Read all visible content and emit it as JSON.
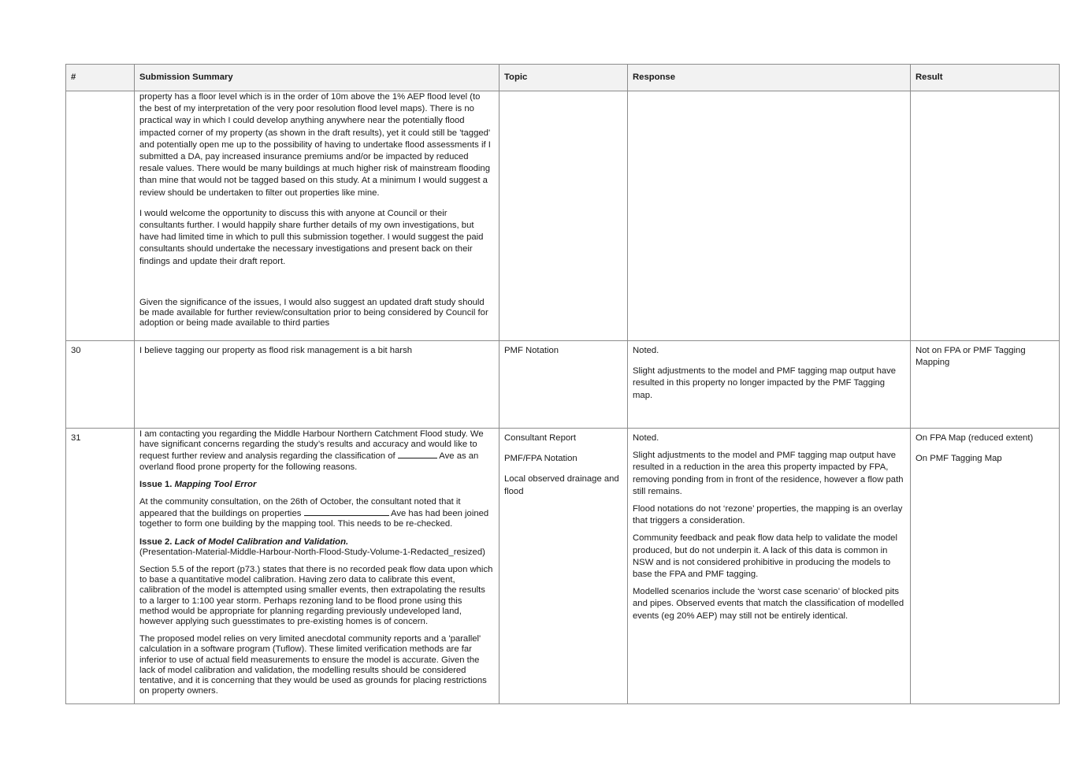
{
  "headers": {
    "num": "#",
    "summary": "Submission Summary",
    "topic": "Topic",
    "response": "Response",
    "result": "Result"
  },
  "row_cont": {
    "p1": "property has a floor level which is in the order of 10m above the 1% AEP flood level (to the best of my interpretation of the very poor resolution flood level maps). There is no practical way in which I could develop anything anywhere near the potentially flood impacted corner of my property (as shown in the draft results), yet it could still be 'tagged' and potentially open me up to the possibility of having to undertake flood assessments if I submitted a DA, pay increased insurance premiums and/or be impacted by reduced resale values. There would be many buildings at much higher risk of mainstream flooding than mine that would not be tagged based on this study. At a minimum I would suggest a review should be undertaken to filter out properties like mine.",
    "p2": "I would welcome the opportunity to discuss this with anyone at Council or their consultants further. I would happily share further details of my own investigations, but have had limited time in which to pull this submission together. I would suggest the paid consultants should undertake the necessary investigations and present back on their findings and update their draft report.",
    "p3": "Given the significance of the issues, I would also suggest an updated draft study should be made available for further review/consultation prior to being considered by Council for adoption or being made available to third parties"
  },
  "row30": {
    "num": "30",
    "summary": "I believe tagging our property as flood risk management is a bit harsh",
    "topic": "PMF Notation",
    "response_1": "Noted.",
    "response_2": "Slight adjustments to the model and PMF tagging map output have resulted in this property no longer impacted by the PMF Tagging map.",
    "result": "Not on FPA or PMF Tagging Mapping"
  },
  "row31": {
    "num": "31",
    "s_p1a": "I am contacting you regarding the Middle Harbour Northern Catchment Flood study. We have significant concerns regarding the study’s results and accuracy and would like to request further review and analysis regarding the classification of ",
    "s_p1b": " Ave as an overland flood prone property for the following reasons.",
    "issue1_label": "Issue 1. ",
    "issue1_title": "Mapping Tool Error",
    "s_p2a": "At the community consultation, on the 26th of October, the consultant noted that it appeared that the buildings on properties ",
    "s_p2b": " Ave has had been joined together to form one building by the mapping tool. This needs to be re-checked.",
    "issue2_label": "Issue 2. ",
    "issue2_title": "Lack of Model Calibration and Validation.",
    "issue2_ref": "(Presentation-Material-Middle-Harbour-North-Flood-Study-Volume-1-Redacted_resized)",
    "s_p4": "Section 5.5 of the report (p73.) states that there is no recorded peak flow data upon which to base a quantitative model calibration. Having zero data to calibrate this event, calibration of the model is attempted using smaller events, then extrapolating the results to a larger to 1:100 year storm. Perhaps rezoning land to be flood prone using this method would be appropriate for planning regarding previously undeveloped land, however applying such guesstimates to pre-existing homes is of concern.",
    "s_p5": "The proposed model relies on very limited anecdotal community reports and a 'parallel' calculation in a software program (Tuflow). These limited verification methods are far inferior to use of actual field measurements to ensure the model is accurate. Given the lack of model calibration and validation, the modelling results should be considered tentative, and it is concerning that they would be used as grounds for placing restrictions on property owners.",
    "topics": [
      "Consultant Report",
      "PMF/FPA Notation",
      "Local observed drainage and flood"
    ],
    "responses": [
      "Noted.",
      "Slight adjustments to the model and PMF tagging map output have resulted in a reduction in the area this property impacted by  FPA, removing ponding from in front of the residence, however a flow path still remains.",
      "Flood notations do not ‘rezone’ properties, the mapping is an overlay that triggers a consideration.",
      "Community feedback and peak flow data help to validate the model produced, but do not underpin it. A lack of this data is common in NSW and is not considered prohibitive in producing the models to base the FPA and PMF tagging.",
      "Modelled scenarios include the ‘worst case scenario’ of blocked pits and pipes. Observed events that match the classification of modelled events (eg 20% AEP) may still not be entirely identical."
    ],
    "results": [
      "On FPA Map (reduced extent)",
      "On PMF Tagging Map"
    ]
  }
}
